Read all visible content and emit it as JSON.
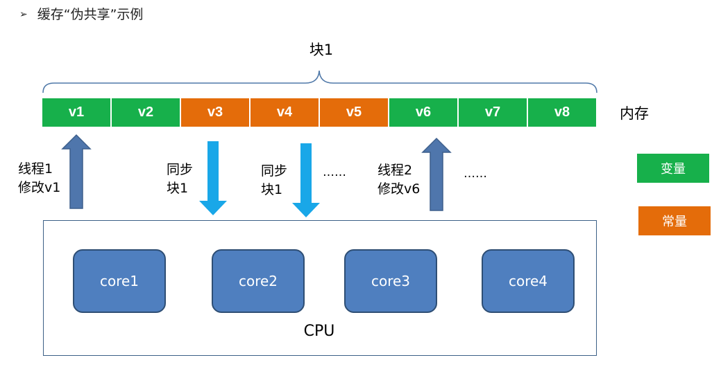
{
  "title": {
    "bullet": "➢",
    "text": "缓存“伪共享”示例"
  },
  "block_label": "块1",
  "memory": {
    "label": "内存",
    "cells": [
      {
        "label": "v1",
        "kind": "variable"
      },
      {
        "label": "v2",
        "kind": "variable"
      },
      {
        "label": "v3",
        "kind": "constant"
      },
      {
        "label": "v4",
        "kind": "constant"
      },
      {
        "label": "v5",
        "kind": "constant"
      },
      {
        "label": "v6",
        "kind": "variable"
      },
      {
        "label": "v7",
        "kind": "variable"
      },
      {
        "label": "v8",
        "kind": "variable"
      }
    ]
  },
  "legend": {
    "variable": "变量",
    "constant": "常量"
  },
  "annotations": {
    "thread1": [
      "线程1",
      "修改v1"
    ],
    "sync_a": [
      "同步",
      "块1"
    ],
    "sync_b": [
      "同步",
      "块1"
    ],
    "thread2": [
      "线程2",
      "修改v6"
    ],
    "ellipsis_1": "……",
    "ellipsis_2": "……"
  },
  "cpu": {
    "label": "CPU",
    "cores": [
      "core1",
      "core2",
      "core3",
      "core4"
    ]
  },
  "colors": {
    "variable": "#17b04b",
    "constant": "#e46c0a",
    "up_arrow": "#4f76ac",
    "down_arrow": "#19a7e8",
    "core_fill": "#4f7fbf",
    "brace": "#4f78a8"
  }
}
